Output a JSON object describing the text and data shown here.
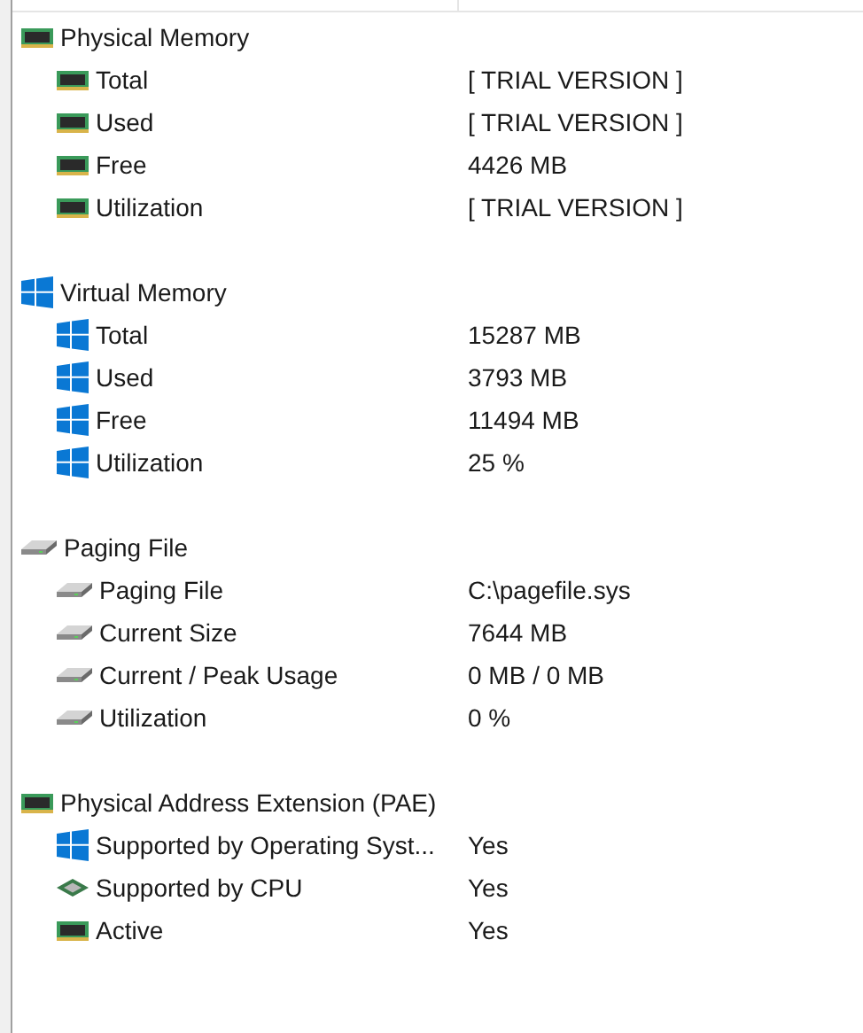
{
  "groups": [
    {
      "label": "Physical Memory",
      "kind": "ram",
      "items": [
        {
          "label": "Total",
          "kind": "ram",
          "value": "[ TRIAL VERSION ]"
        },
        {
          "label": "Used",
          "kind": "ram",
          "value": "[ TRIAL VERSION ]"
        },
        {
          "label": "Free",
          "kind": "ram",
          "value": "4426 MB"
        },
        {
          "label": "Utilization",
          "kind": "ram",
          "value": "[ TRIAL VERSION ]"
        }
      ]
    },
    {
      "label": "Virtual Memory",
      "kind": "windows",
      "items": [
        {
          "label": "Total",
          "kind": "windows",
          "value": "15287 MB"
        },
        {
          "label": "Used",
          "kind": "windows",
          "value": "3793 MB"
        },
        {
          "label": "Free",
          "kind": "windows",
          "value": "11494 MB"
        },
        {
          "label": "Utilization",
          "kind": "windows",
          "value": "25 %"
        }
      ]
    },
    {
      "label": "Paging File",
      "kind": "drive",
      "items": [
        {
          "label": "Paging File",
          "kind": "drive",
          "value": "C:\\pagefile.sys"
        },
        {
          "label": "Current Size",
          "kind": "drive",
          "value": "7644 MB"
        },
        {
          "label": "Current / Peak Usage",
          "kind": "drive",
          "value": "0 MB / 0 MB"
        },
        {
          "label": "Utilization",
          "kind": "drive",
          "value": "0 %"
        }
      ]
    },
    {
      "label": "Physical Address Extension (PAE)",
      "kind": "ram",
      "items": [
        {
          "label": "Supported by Operating Syst...",
          "kind": "windows",
          "value": "Yes"
        },
        {
          "label": "Supported by CPU",
          "kind": "cpu",
          "value": "Yes"
        },
        {
          "label": "Active",
          "kind": "ram",
          "value": "Yes"
        }
      ]
    }
  ]
}
